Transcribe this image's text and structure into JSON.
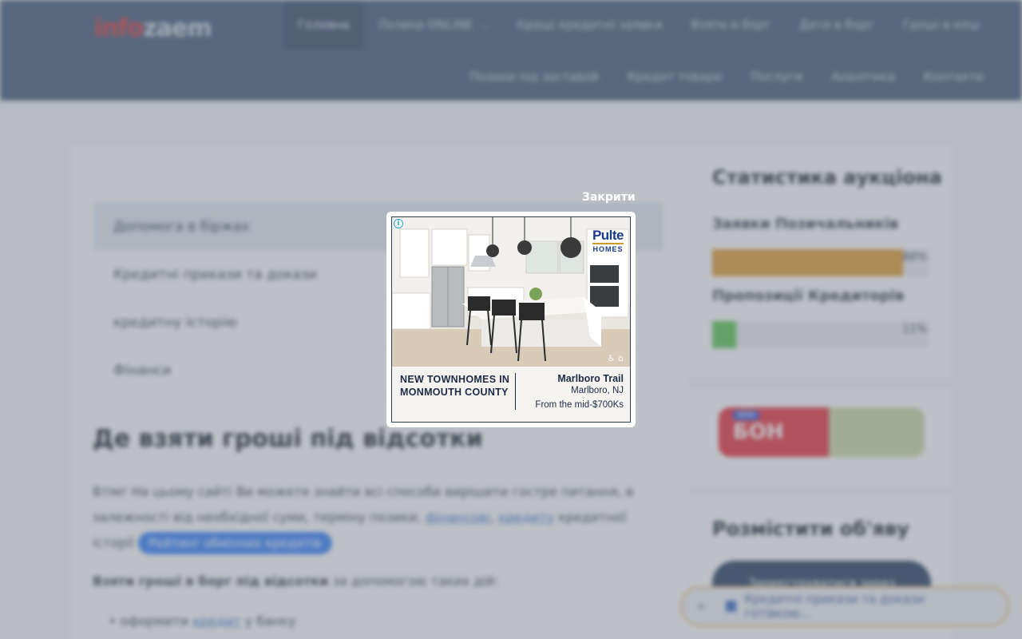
{
  "site": {
    "logo_part1": "info",
    "logo_part2": "zaem"
  },
  "nav": {
    "row1": [
      "Головна",
      "Позики ONLINE",
      "Кращі кредитні заявки",
      "Взяти в борг",
      "Дати в борг",
      "Гроші в кеш"
    ],
    "row2": [
      "Позики під заставой",
      "Кредит товари",
      "Послуги",
      "Аналітика",
      "Контакти"
    ]
  },
  "tabs": [
    "Допомога в біржах",
    "Кредитні прикази та докази",
    "кредитну історію",
    "Фінанси"
  ],
  "article": {
    "heading": "Де взяти гроші під відсотки",
    "para1": "Втім! На цьому сайті Ви можете знайти всі способи вирішити гостре питання, в залежності від необхідної суми, терміну позики,",
    "para1_link": "фінансові",
    "para1_link2": "кредиту",
    "para1_end": "кредитної історії",
    "pill": "Рейтинг обмінних кредитів",
    "para2_bold": "Взяти гроші в борг під відсотки",
    "para2_rest": " за допомогою таких дій:",
    "bullet": "оформити",
    "bullet_link": "кредит",
    "bullet_end": " у банку"
  },
  "sidebar": {
    "stats_title": "Статистика аукціона",
    "bar1_label": "Заявки Позичальників",
    "bar1_pct": "88%",
    "bar1_value": 0.88,
    "bar1_color": "#d99b3a",
    "bar2_label": "Пропозиції Кредиторів",
    "bar2_pct": "11%",
    "bar2_value": 0.11,
    "bar2_color": "#5cc25a",
    "banner_tag": "NEW",
    "banner_text": "БОН",
    "post_title": "Розмістити об'яву",
    "post_button": "Зареєструватися зараз"
  },
  "sticky": {
    "close": "×",
    "text": "Кредитні прикази та докази готівкою..."
  },
  "modal": {
    "close_label": "Закрити",
    "ad": {
      "info": "i",
      "brand_top": "Pulte",
      "brand_bottom": "HOMES",
      "headline": "NEW TOWNHOMES IN MONMOUTH COUNTY",
      "community": "Marlboro Trail",
      "location": "Marlboro, NJ",
      "price": "From the mid-$700Ks",
      "access_icons": "♿ ⌂"
    }
  }
}
